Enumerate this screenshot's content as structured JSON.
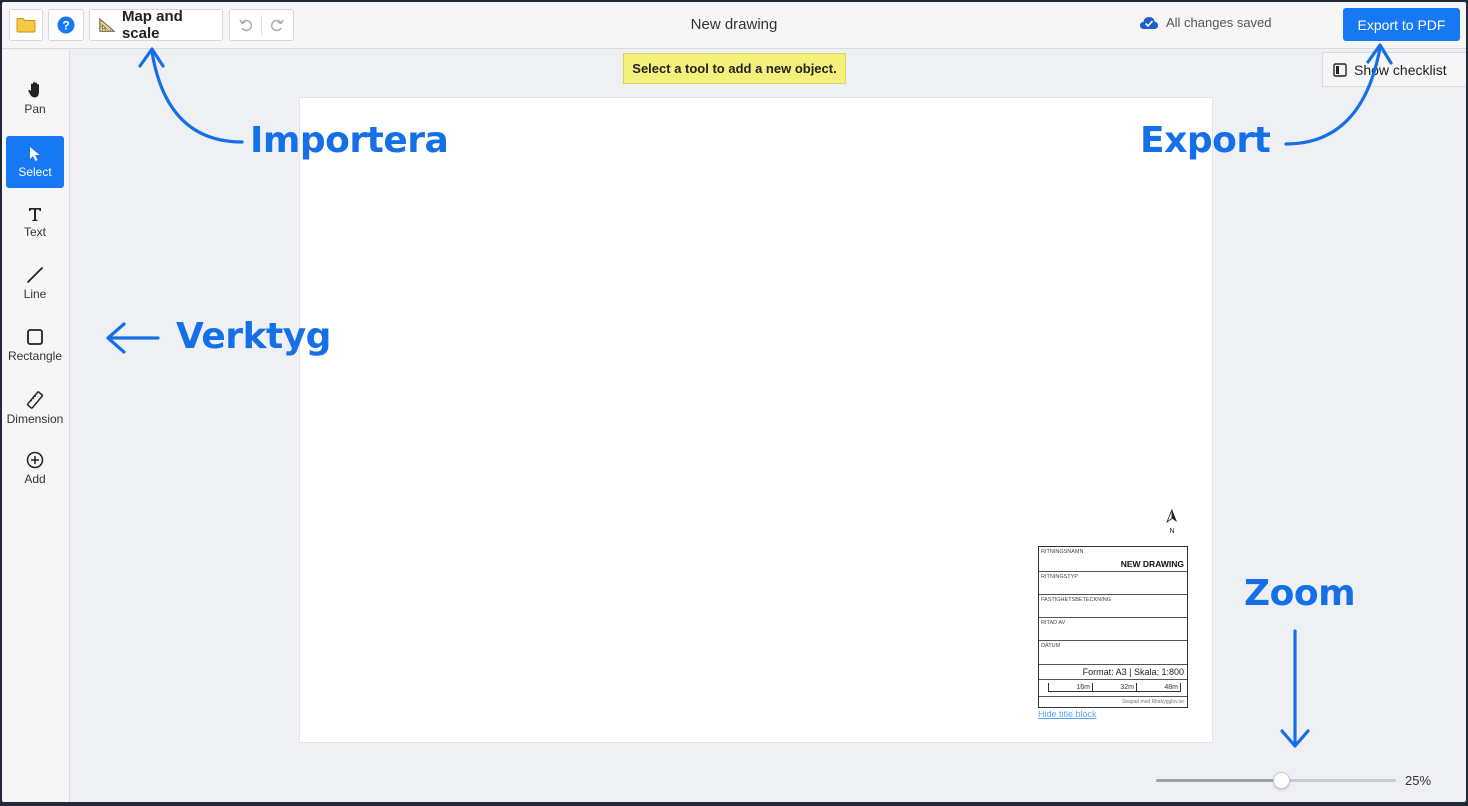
{
  "toolbar": {
    "map_scale_label": "Map and scale",
    "title": "New drawing",
    "saved_status": "All changes saved",
    "export_label": "Export to PDF"
  },
  "tools": [
    {
      "id": "pan",
      "label": "Pan",
      "icon": "hand-icon",
      "active": false
    },
    {
      "id": "select",
      "label": "Select",
      "icon": "pointer-icon",
      "active": true
    },
    {
      "id": "text",
      "label": "Text",
      "icon": "text-icon",
      "active": false
    },
    {
      "id": "line",
      "label": "Line",
      "icon": "line-icon",
      "active": false
    },
    {
      "id": "rectangle",
      "label": "Rectangle",
      "icon": "rectangle-icon",
      "active": false
    },
    {
      "id": "dimension",
      "label": "Dimension",
      "icon": "ruler-icon",
      "active": false
    },
    {
      "id": "add",
      "label": "Add",
      "icon": "plus-circle-icon",
      "active": false
    }
  ],
  "hint": "Select a tool to add a new object.",
  "checklist_label": "Show checklist",
  "north_label": "N",
  "title_block": {
    "name_label": "RITNINGSNAMN",
    "name_value": "NEW DRAWING",
    "type_label": "RITNINGSTYP",
    "property_label": "FASTIGHETSBETECKNING",
    "drawn_by_label": "RITAD AV",
    "date_label": "DATUM",
    "format_text": "Format: A3 | Skala: 1:800",
    "scale_marks": [
      "16m",
      "32m",
      "48m"
    ],
    "credit": "Skapad med Ritabygglov.se",
    "hide_link": "Hide title block"
  },
  "zoom": {
    "percent_label": "25%",
    "fraction": 0.52
  },
  "annotations": {
    "import": "Importera",
    "export": "Export",
    "tools": "Verktyg",
    "zoom": "Zoom"
  },
  "colors": {
    "accent": "#1678f2",
    "annotation": "#1570e8",
    "hint_bg": "#f4f07c"
  }
}
